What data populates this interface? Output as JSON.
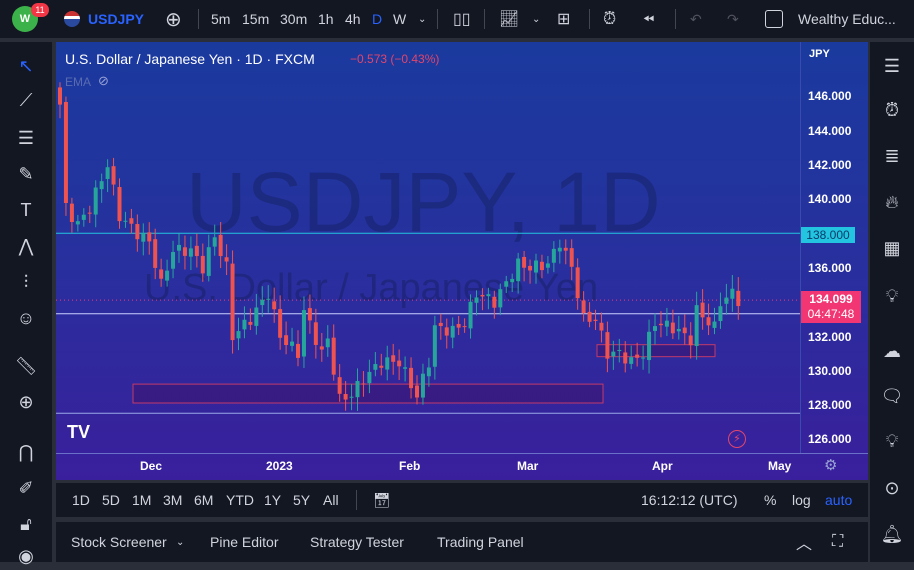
{
  "topbar": {
    "notification_count": "11",
    "symbol": "USDJPY",
    "intervals": [
      "5m",
      "15m",
      "30m",
      "1h",
      "4h",
      "D",
      "W"
    ],
    "active_interval": "D",
    "account": "Wealthy Educ..."
  },
  "chart": {
    "title": "U.S. Dollar / Japanese Yen · 1D · FXCM",
    "change": "−0.573 (−0.43%)",
    "indicator": "EMA",
    "watermark_symbol": "USDJPY, 1D",
    "watermark_name": "U.S. Dollar / Japanese Yen",
    "currency": "JPY",
    "price_labels": [
      "146.000",
      "144.000",
      "142.000",
      "140.000",
      "136.000",
      "132.000",
      "130.000",
      "128.000",
      "126.000"
    ],
    "line_label": "138.000",
    "last_price": "134.099",
    "countdown": "04:47:48",
    "time_labels": [
      "Dec",
      "2023",
      "Feb",
      "Mar",
      "Apr",
      "May"
    ],
    "colors": {
      "up": "#26a69a",
      "down": "#ef5350",
      "line": "#22c4e0",
      "last": "#f23673"
    }
  },
  "chart_data": {
    "type": "candlestick",
    "ylim": [
      125,
      147
    ],
    "bars": 115,
    "close_path": [
      [
        0,
        145.5
      ],
      [
        1,
        139.5
      ],
      [
        3,
        138.5
      ],
      [
        5,
        139.5
      ],
      [
        8,
        142
      ],
      [
        10,
        139
      ],
      [
        13,
        138
      ],
      [
        15,
        137.5
      ],
      [
        17,
        135
      ],
      [
        19,
        137
      ],
      [
        22,
        137
      ],
      [
        24,
        136
      ],
      [
        26,
        137.8
      ],
      [
        28,
        136
      ],
      [
        29,
        132
      ],
      [
        32,
        133
      ],
      [
        35,
        134.5
      ],
      [
        37,
        132
      ],
      [
        40,
        131
      ],
      [
        41,
        133.5
      ],
      [
        44,
        131
      ],
      [
        45,
        131.8
      ],
      [
        47,
        128.3
      ],
      [
        49,
        128.6
      ],
      [
        51,
        129.5
      ],
      [
        54,
        130.5
      ],
      [
        57,
        130.5
      ],
      [
        60,
        128.5
      ],
      [
        62,
        130.5
      ],
      [
        63,
        132.5
      ],
      [
        66,
        132.3
      ],
      [
        68,
        132.8
      ],
      [
        70,
        134.5
      ],
      [
        73,
        134
      ],
      [
        77,
        136.2
      ],
      [
        79,
        136
      ],
      [
        82,
        136.2
      ],
      [
        84,
        137.5
      ],
      [
        86,
        136
      ],
      [
        88,
        133
      ],
      [
        90,
        133
      ],
      [
        92,
        131
      ],
      [
        94,
        131
      ],
      [
        96,
        130.5
      ],
      [
        98,
        131
      ],
      [
        100,
        132.8
      ],
      [
        103,
        132.5
      ],
      [
        106,
        131.8
      ],
      [
        107,
        133.5
      ],
      [
        110,
        132.5
      ],
      [
        111,
        134
      ],
      [
        113,
        134.5
      ],
      [
        114,
        134.1
      ]
    ],
    "horizontal_lines": [
      138.0,
      133.3,
      127.5
    ],
    "zones": [
      [
        128.1,
        129.2
      ],
      [
        130.8,
        131.5
      ]
    ]
  },
  "bottombar": {
    "ranges": [
      "1D",
      "5D",
      "1M",
      "3M",
      "6M",
      "YTD",
      "1Y",
      "5Y",
      "All"
    ],
    "clock": "16:12:12 (UTC)",
    "percent": "%",
    "log": "log",
    "auto": "auto"
  },
  "panel": {
    "tabs": [
      "Stock Screener",
      "Pine Editor",
      "Strategy Tester",
      "Trading Panel"
    ]
  }
}
